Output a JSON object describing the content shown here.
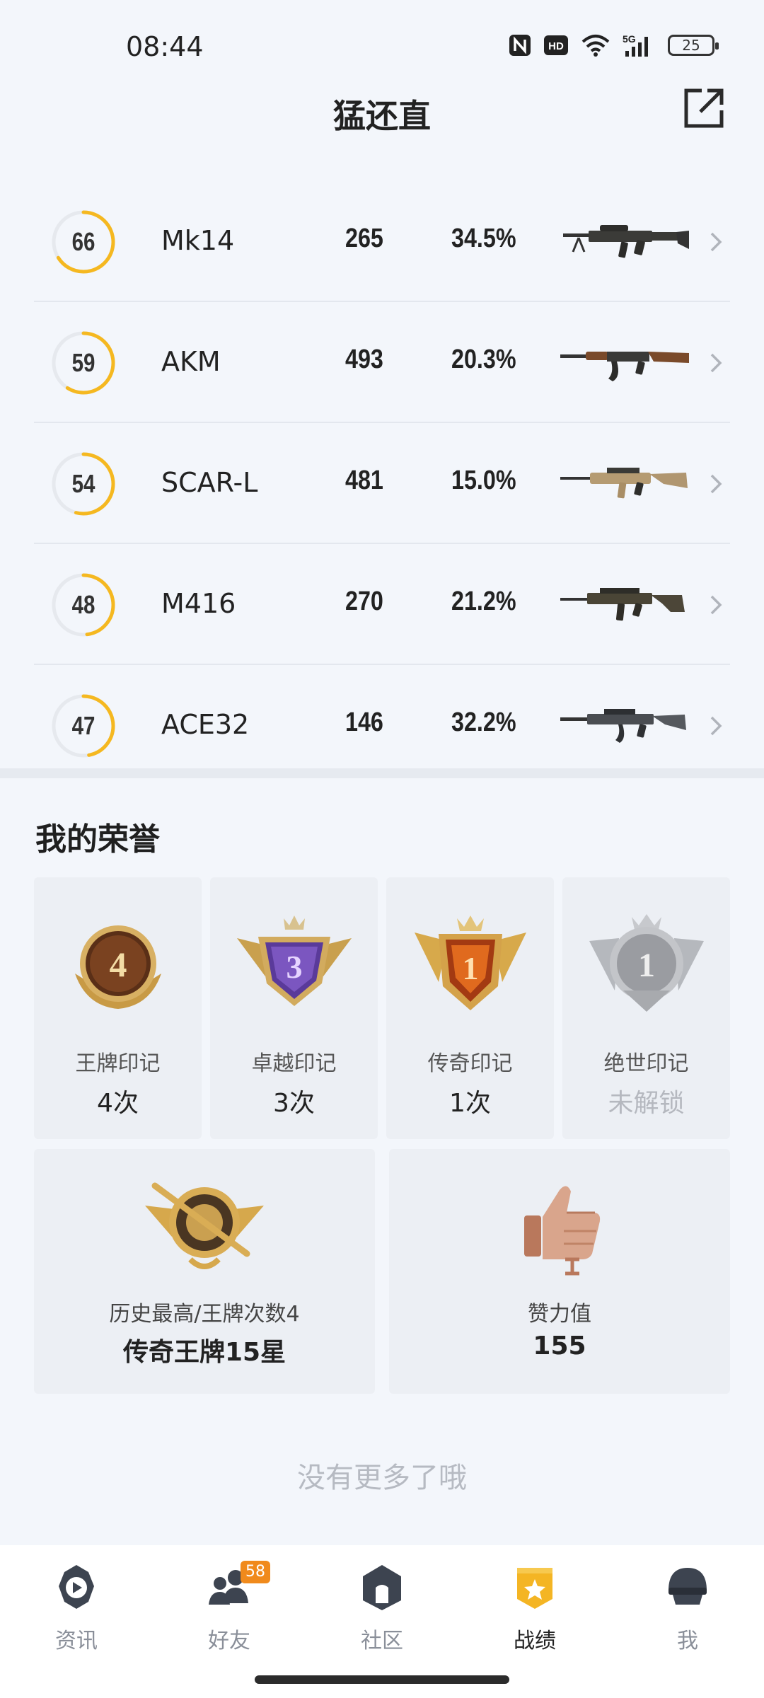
{
  "status_bar": {
    "time": "08:44",
    "battery": "25",
    "network": "5G"
  },
  "header": {
    "title": "猛还直"
  },
  "colors": {
    "accent": "#f5b820",
    "ring_track": "#e6e9ee",
    "badge": "#f08a1c"
  },
  "weapons": [
    {
      "score": "66",
      "score_pct": 0.66,
      "name": "Mk14",
      "count": "265",
      "rate": "34.5%",
      "icon": "dmr-rifle-icon"
    },
    {
      "score": "59",
      "score_pct": 0.59,
      "name": "AKM",
      "count": "493",
      "rate": "20.3%",
      "icon": "akm-rifle-icon"
    },
    {
      "score": "54",
      "score_pct": 0.54,
      "name": "SCAR-L",
      "count": "481",
      "rate": "15.0%",
      "icon": "scar-rifle-icon"
    },
    {
      "score": "48",
      "score_pct": 0.48,
      "name": "M416",
      "count": "270",
      "rate": "21.2%",
      "icon": "m416-rifle-icon"
    },
    {
      "score": "47",
      "score_pct": 0.47,
      "name": "ACE32",
      "count": "146",
      "rate": "32.2%",
      "icon": "ace32-rifle-icon"
    }
  ],
  "honors": {
    "title": "我的荣誉",
    "cards": [
      {
        "badge_number": "4",
        "label": "王牌印记",
        "value": "4次",
        "locked": false
      },
      {
        "badge_number": "3",
        "label": "卓越印记",
        "value": "3次",
        "locked": false
      },
      {
        "badge_number": "1",
        "label": "传奇印记",
        "value": "1次",
        "locked": false
      },
      {
        "badge_number": "1",
        "label": "绝世印记",
        "value": "未解锁",
        "locked": true
      }
    ],
    "highest": {
      "label": "历史最高/王牌次数4",
      "value": "传奇王牌15星"
    },
    "likes": {
      "label": "赞力值",
      "value": "155"
    }
  },
  "footer_text": "没有更多了哦",
  "nav": [
    {
      "label": "资讯",
      "icon": "news-play-icon",
      "active": false
    },
    {
      "label": "好友",
      "icon": "friends-icon",
      "active": false,
      "badge": "58"
    },
    {
      "label": "社区",
      "icon": "community-icon",
      "active": false
    },
    {
      "label": "战绩",
      "icon": "record-star-icon",
      "active": true
    },
    {
      "label": "我",
      "icon": "helmet-icon",
      "active": false
    }
  ]
}
